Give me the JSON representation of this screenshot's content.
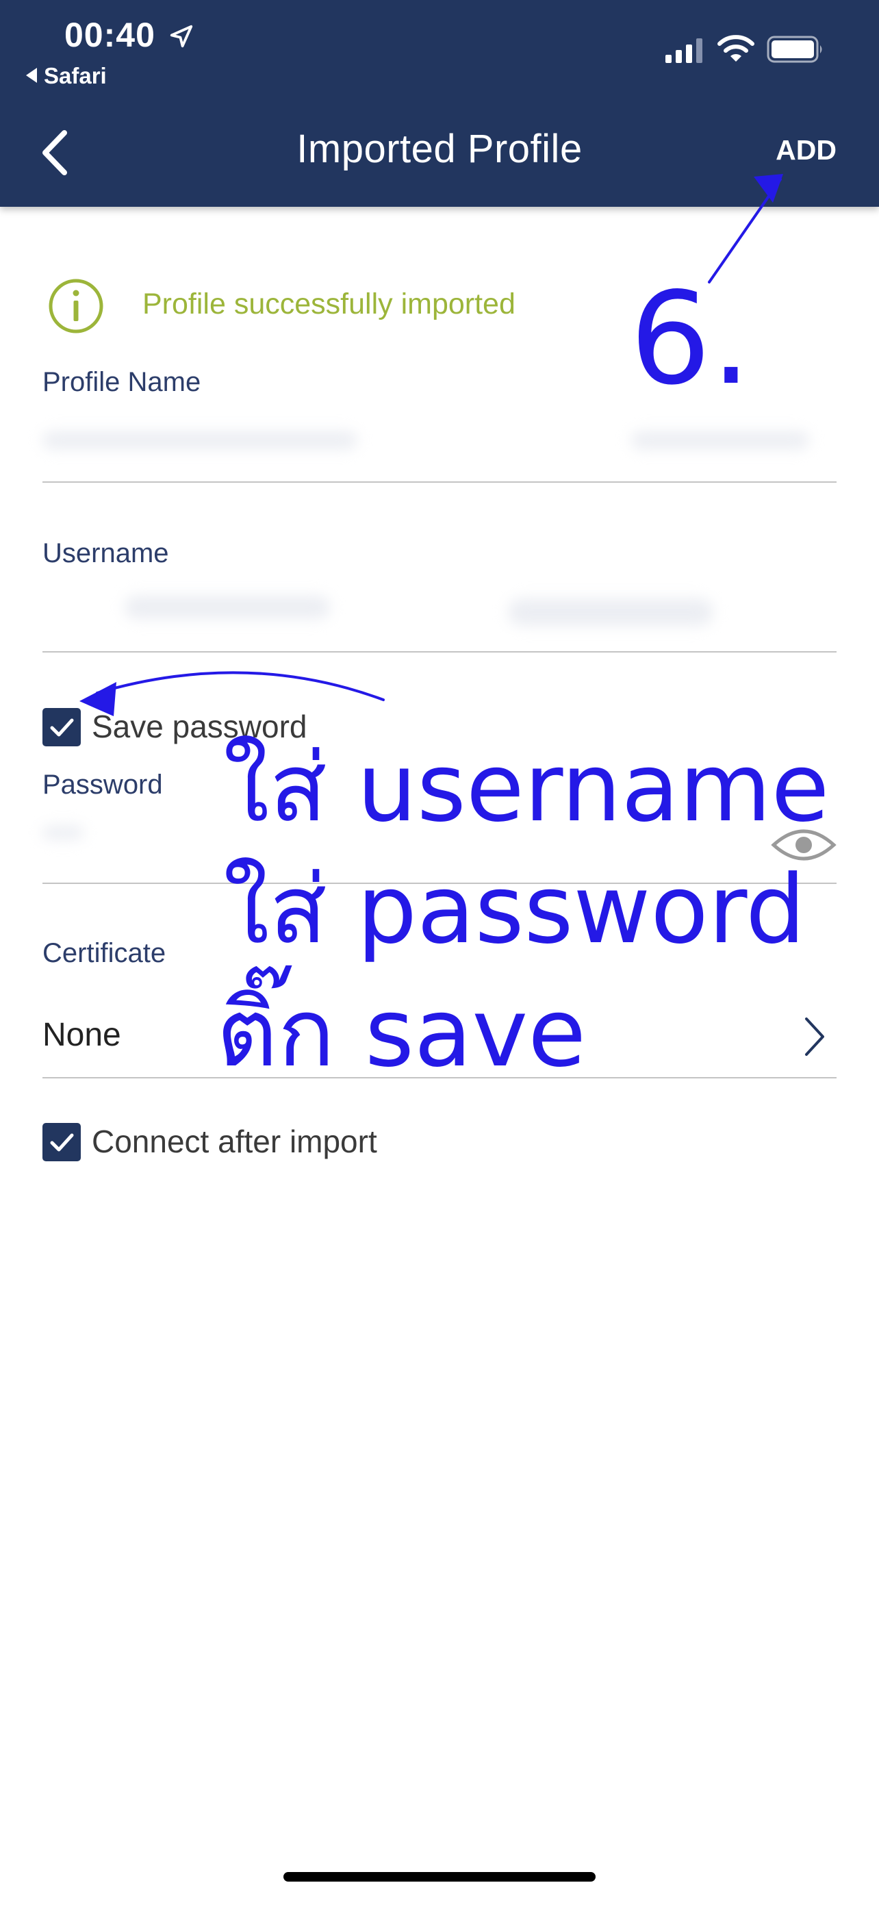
{
  "status_bar": {
    "time": "00:40",
    "back_app": "Safari",
    "icons": [
      "location-icon",
      "signal-icon",
      "wifi-icon",
      "battery-icon"
    ]
  },
  "nav": {
    "title": "Imported Profile",
    "action": "ADD",
    "back_icon": "chevron-left-icon"
  },
  "notice": {
    "text": "Profile successfully imported",
    "icon": "info-icon",
    "color": "#9cb53a"
  },
  "form": {
    "profile_name": {
      "label": "Profile Name",
      "value": ""
    },
    "username": {
      "label": "Username",
      "value": ""
    },
    "save_password": {
      "label": "Save password",
      "checked": true
    },
    "password": {
      "label": "Password",
      "value": ""
    },
    "certificate": {
      "label": "Certificate",
      "value": "None"
    },
    "connect_after_import": {
      "label": "Connect after import",
      "checked": true
    }
  },
  "annotations": {
    "step": "6.",
    "line1": "ใส่ username",
    "line2": "ใส่ password",
    "line3": "ติ๊ก save",
    "color": "#2419e6"
  },
  "colors": {
    "header": "#22365f",
    "accent": "#22365f",
    "success": "#9cb53a"
  }
}
